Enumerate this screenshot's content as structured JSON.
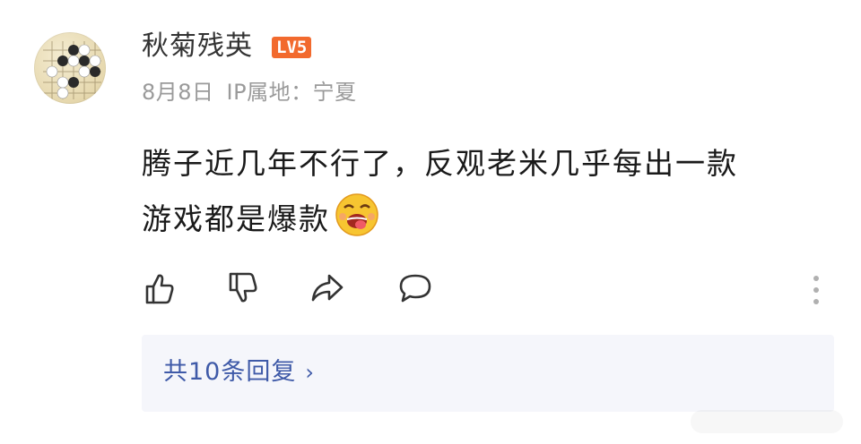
{
  "user": {
    "name": "秋菊残英",
    "level": "LV5",
    "date": "8月8日",
    "ip_label": "IP属地：宁夏"
  },
  "comment": {
    "line1": "腾子近几年不行了，反观老米几乎每出一款",
    "line2": "游戏都是爆款",
    "emoji": "drooling-face-emoji"
  },
  "actions": [
    "like-icon",
    "dislike-icon",
    "share-icon",
    "comment-icon",
    "more-icon"
  ],
  "replies": {
    "label": "共10条回复",
    "chevron": "›"
  },
  "colors": {
    "accent": "#3f5aa8",
    "badge": "#f26a2e",
    "meta": "#9a9a9a"
  }
}
